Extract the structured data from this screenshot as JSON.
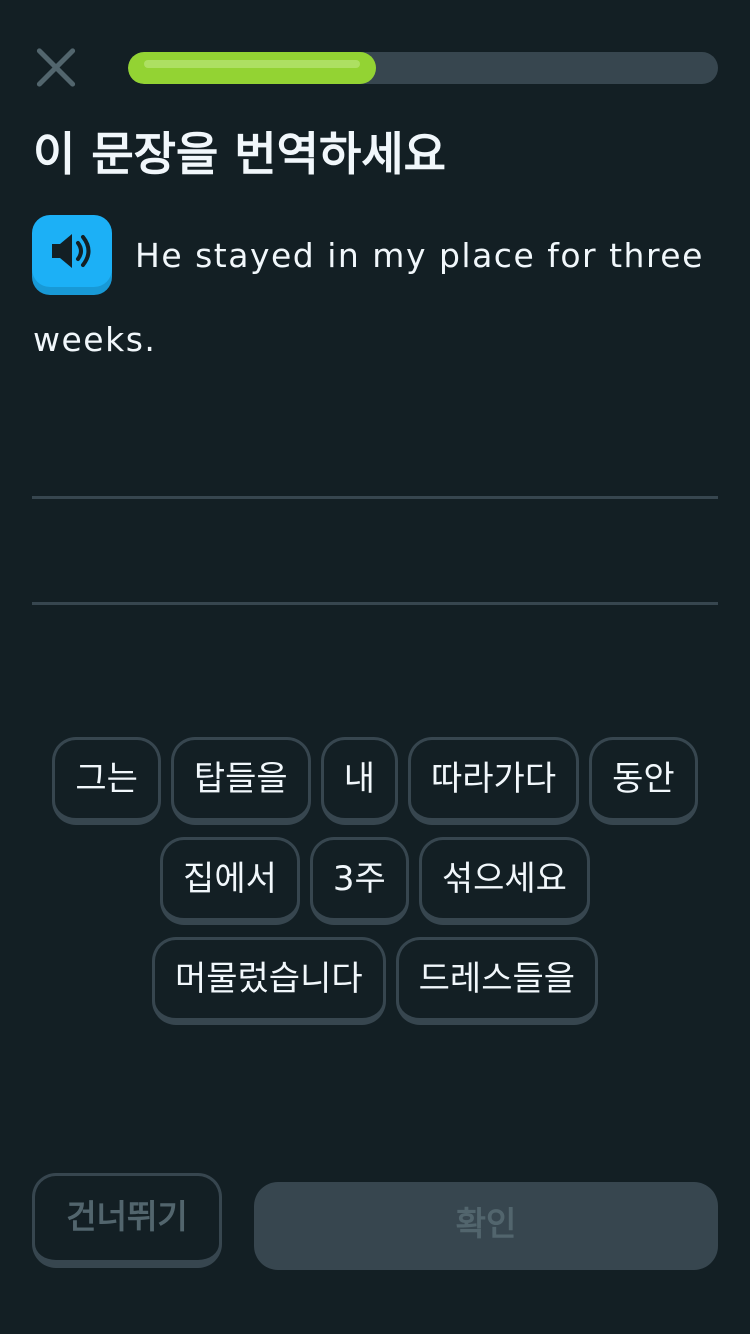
{
  "header": {
    "close_icon": "close-x-icon",
    "progress": 0.42,
    "progress_color": "#93d333"
  },
  "prompt": {
    "title": "이 문장을 번역하세요",
    "speaker_icon": "speaker-icon",
    "sentence_line1": "He stayed in my place for three",
    "sentence_line2": "weeks."
  },
  "word_bank": {
    "rows": [
      [
        "그는",
        "탑들을",
        "내",
        "따라가다",
        "동안"
      ],
      [
        "집에서",
        "3주",
        "섞으세요"
      ],
      [
        "머물렀습니다",
        "드레스들을"
      ]
    ]
  },
  "footer": {
    "skip_label": "건너뛰기",
    "check_label": "확인"
  },
  "colors": {
    "background": "#131f24",
    "accent_blue": "#1cb0f6",
    "border": "#37464f",
    "muted_text": "#52656d"
  }
}
